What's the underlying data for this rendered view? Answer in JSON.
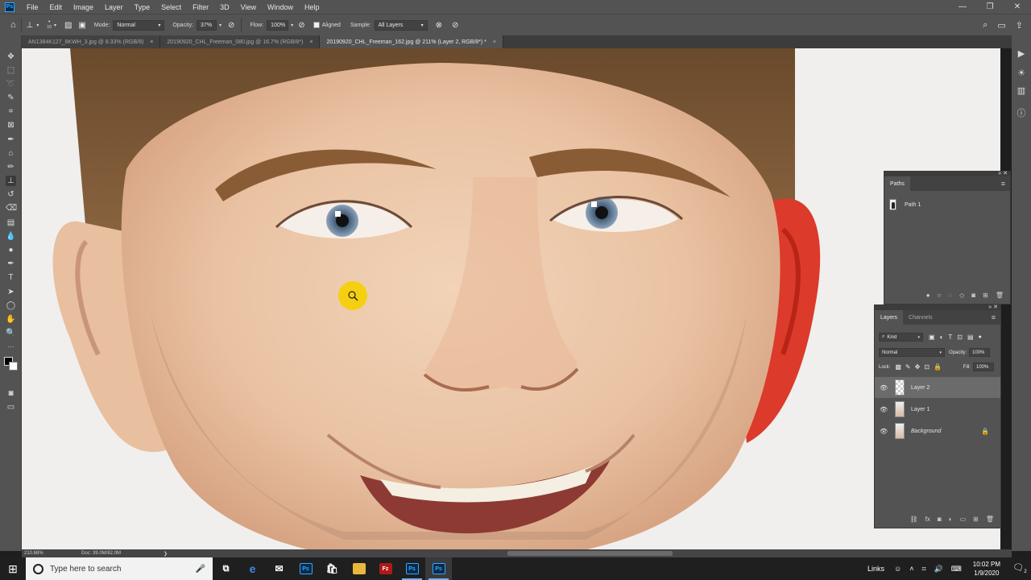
{
  "menubar": {
    "logo": "Ps",
    "items": [
      "File",
      "Edit",
      "Image",
      "Layer",
      "Type",
      "Select",
      "Filter",
      "3D",
      "View",
      "Window",
      "Help"
    ]
  },
  "options": {
    "brush_size": "10",
    "mode_label": "Mode:",
    "mode_value": "Normal",
    "opacity_label": "Opacity:",
    "opacity_value": "37%",
    "flow_label": "Flow:",
    "flow_value": "100%",
    "aligned_label": "Aligned",
    "sample_label": "Sample:",
    "sample_value": "All Layers"
  },
  "tabs": [
    {
      "label": "AN1384K127_8KWH_3.jpg @ 8.33% (RGB/8)",
      "close": "×"
    },
    {
      "label": "20190920_CHL_Freeman_080.jpg @ 16.7% (RGB/8*)",
      "close": "×"
    },
    {
      "label": "20190920_CHL_Freeman_162.jpg @ 211% (Layer 2, RGB/8*) *",
      "close": "×"
    }
  ],
  "status": {
    "zoom": "210.68%",
    "doc": "Doc: 39.0M/82.0M"
  },
  "paths_panel": {
    "title": "Paths",
    "items": [
      "Path 1"
    ]
  },
  "layers_panel": {
    "tab_layers": "Layers",
    "tab_channels": "Channels",
    "kind_label": "Kind",
    "blend_mode": "Normal",
    "opacity_label": "Opacity:",
    "opacity_value": "100%",
    "lock_label": "Lock:",
    "fill_label": "Fill:",
    "fill_value": "100%",
    "layers": [
      {
        "name": "Layer 2",
        "selected": true
      },
      {
        "name": "Layer 1",
        "selected": false
      },
      {
        "name": "Background",
        "selected": false,
        "locked": true
      }
    ]
  },
  "taskbar": {
    "search_placeholder": "Type here to search",
    "links": "Links",
    "time": "10:02 PM",
    "date": "1/9/2020",
    "notification_count": "2"
  },
  "colors": {
    "ui_bg": "#535353",
    "panel_header": "#424242",
    "ps_blue": "#31a8ff",
    "cursor_highlight": "#f5d000"
  }
}
